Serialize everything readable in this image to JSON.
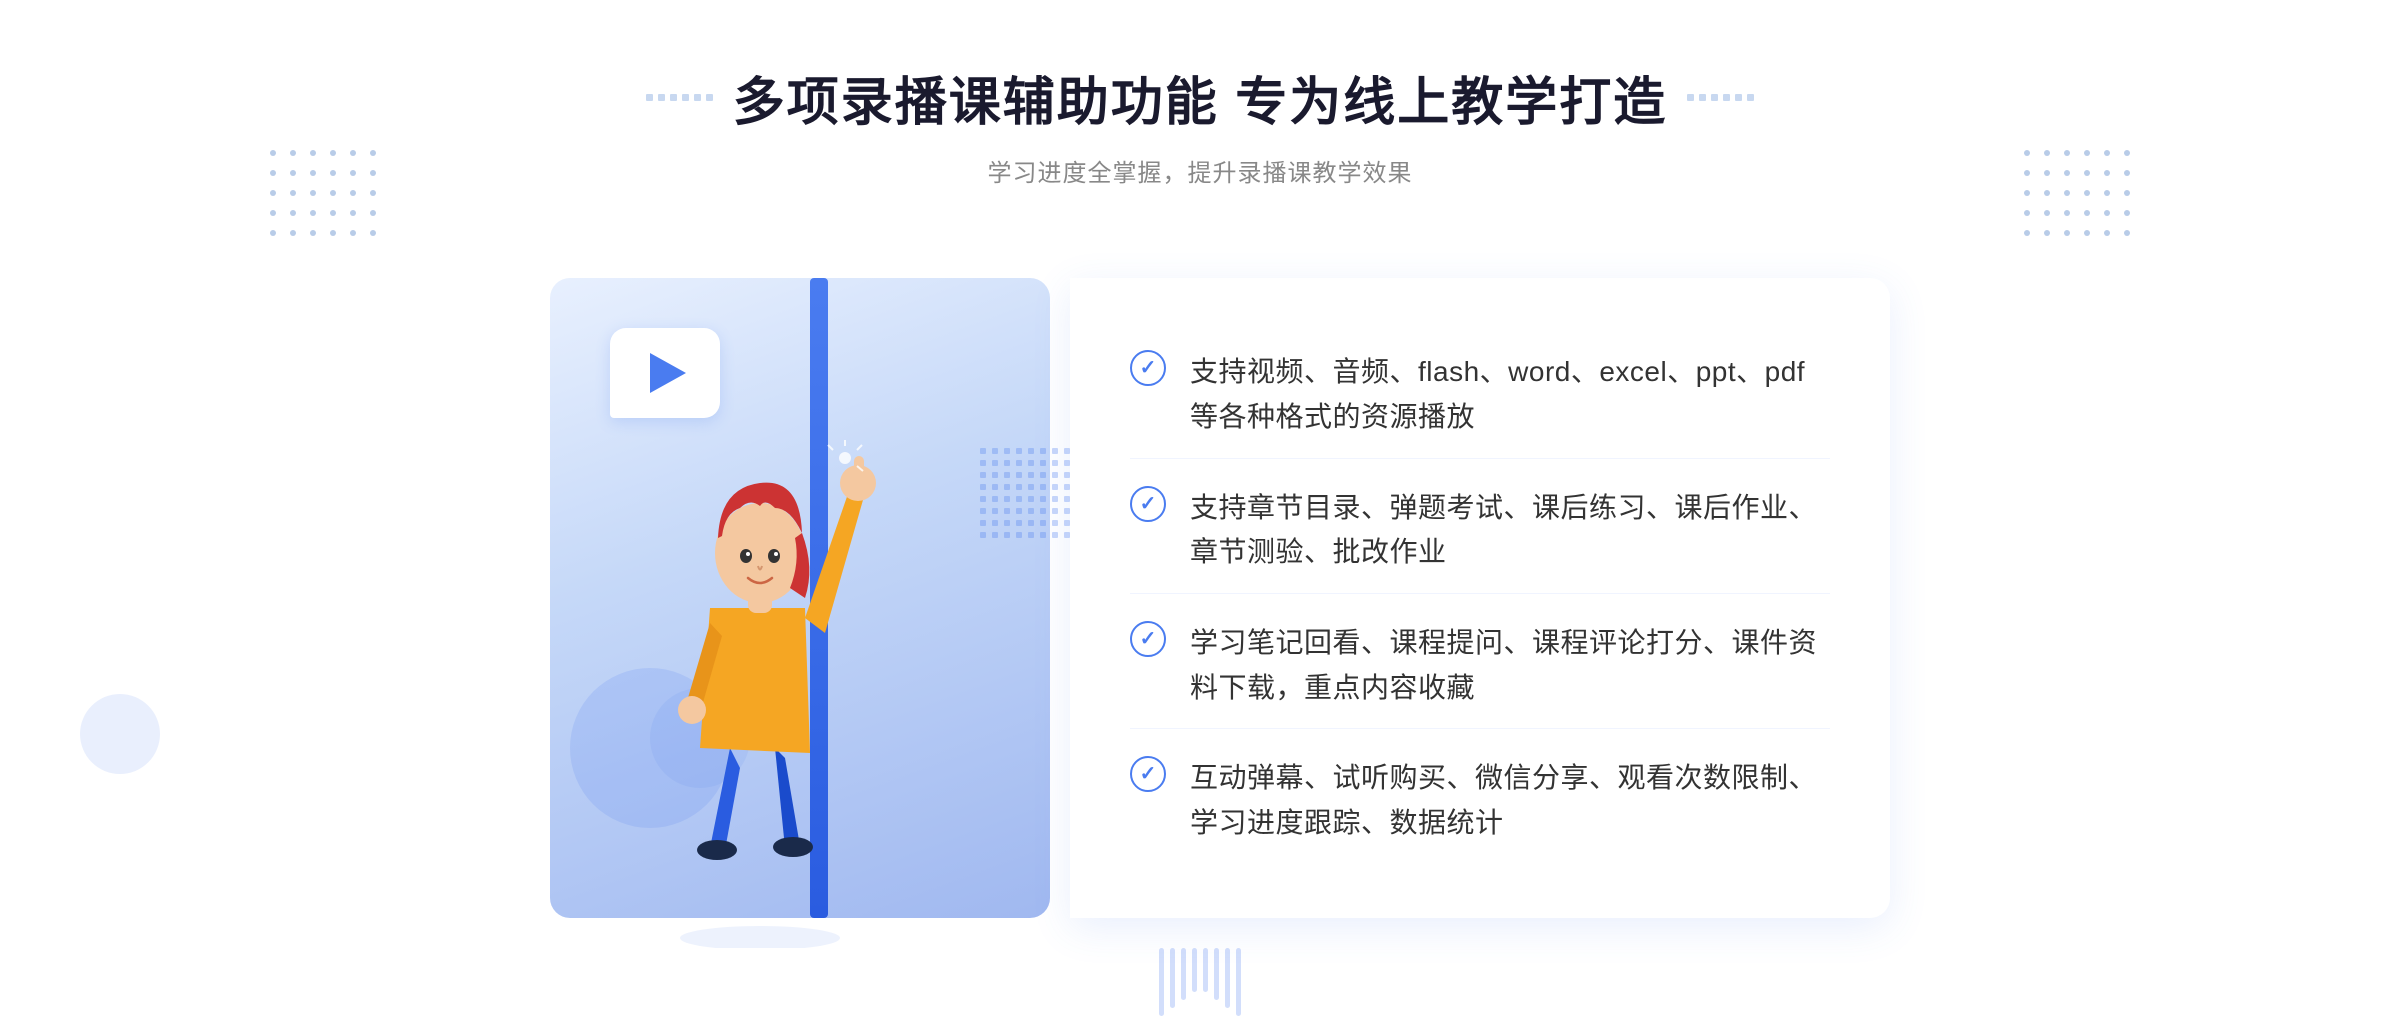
{
  "header": {
    "title": "多项录播课辅助功能 专为线上教学打造",
    "subtitle": "学习进度全掌握，提升录播课教学效果",
    "decorator_left": "❖",
    "decorator_right": "❖"
  },
  "features": [
    {
      "id": "feature-1",
      "text": "支持视频、音频、flash、word、excel、ppt、pdf等各种格式的资源播放"
    },
    {
      "id": "feature-2",
      "text": "支持章节目录、弹题考试、课后练习、课后作业、章节测验、批改作业"
    },
    {
      "id": "feature-3",
      "text": "学习笔记回看、课程提问、课程评论打分、课件资料下载，重点内容收藏"
    },
    {
      "id": "feature-4",
      "text": "互动弹幕、试听购买、微信分享、观看次数限制、学习进度跟踪、数据统计"
    }
  ],
  "nav": {
    "arrow": "»"
  },
  "colors": {
    "primary": "#4a7cf0",
    "primary_light": "#e8f0fe",
    "text_dark": "#1a1a2e",
    "text_gray": "#888888",
    "text_body": "#333333"
  }
}
